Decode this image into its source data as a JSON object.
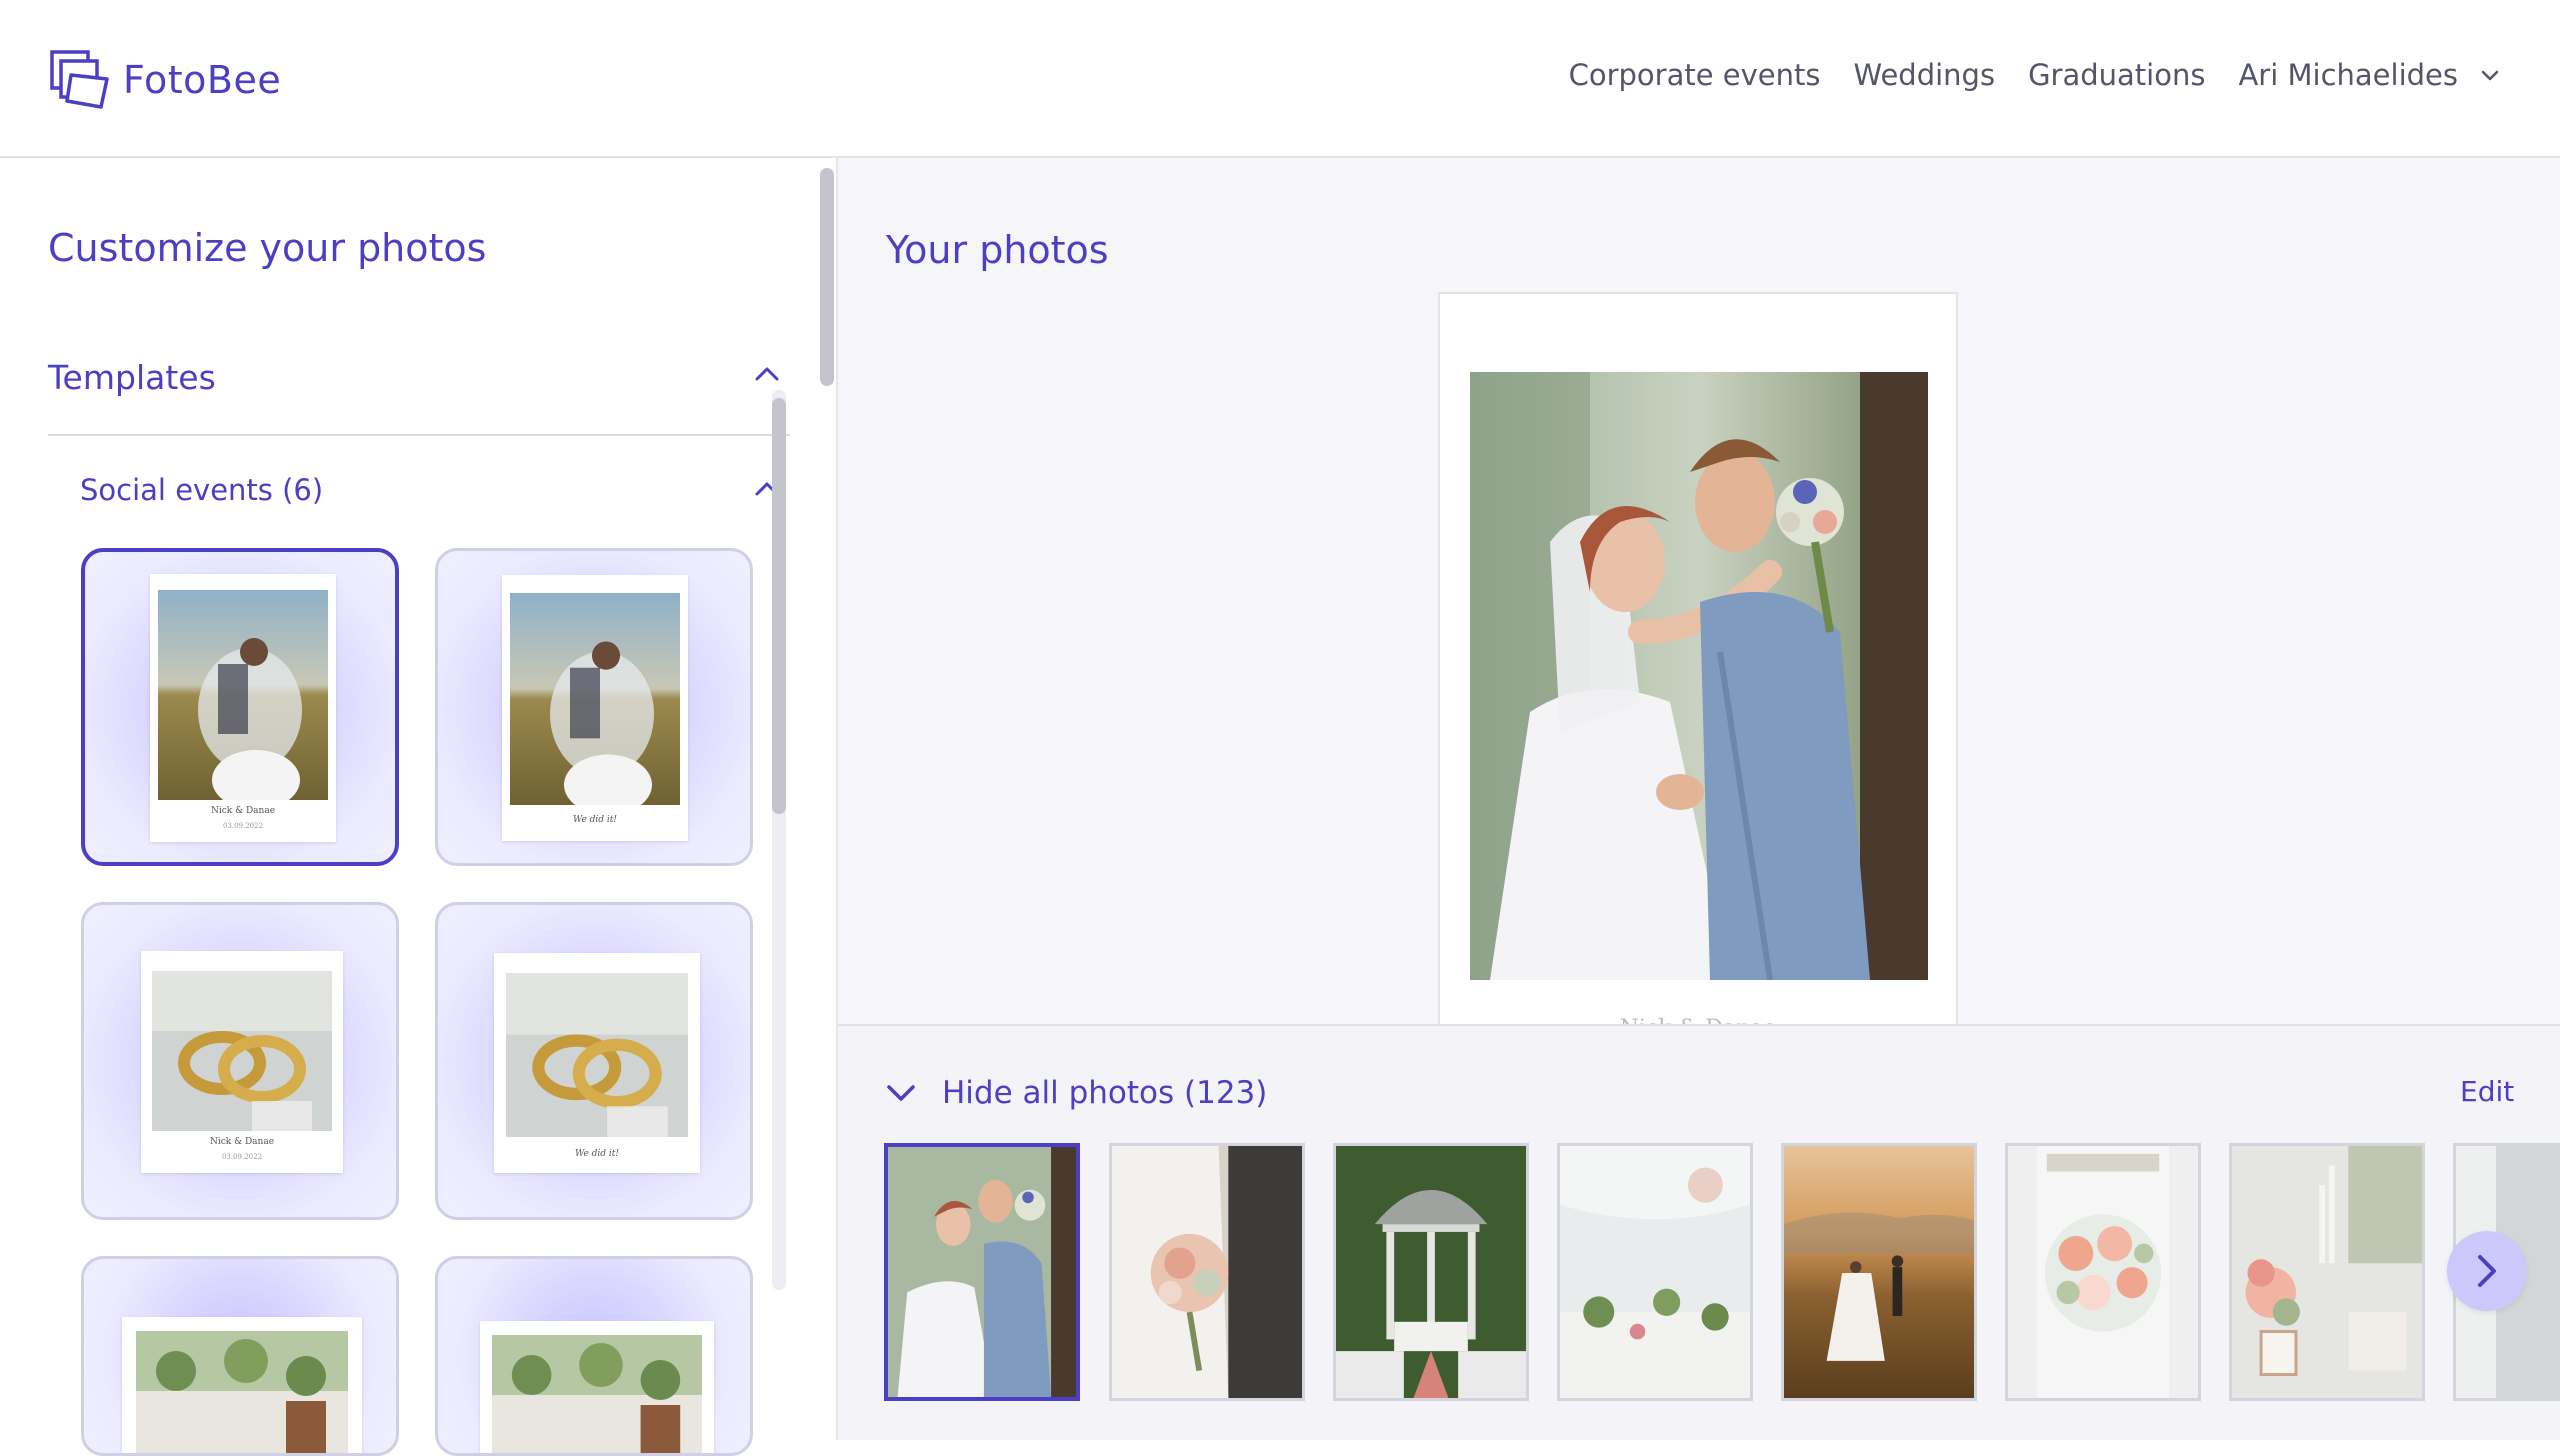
{
  "header": {
    "logo_text": "FotoBee",
    "nav": [
      "Corporate events",
      "Weddings",
      "Graduations"
    ],
    "user_name": "Ari Michaelides"
  },
  "customize": {
    "title": "Customize your photos",
    "section_label": "Templates",
    "subsection_label": "Social events (6)",
    "templates": [
      {
        "photo": "couple-veil-field",
        "caption": "Nick & Danae",
        "date": "03.09.2022",
        "selected": true
      },
      {
        "photo": "couple-veil-field",
        "caption": "We did it!",
        "selected": false
      },
      {
        "photo": "gold-wedding-rings",
        "caption": "Nick & Danae",
        "date": "03.09.2022",
        "selected": false
      },
      {
        "photo": "gold-wedding-rings",
        "caption": "We did it!",
        "selected": false
      },
      {
        "photo": "banquet-table",
        "selected": false
      },
      {
        "photo": "banquet-table",
        "selected": false
      }
    ]
  },
  "preview": {
    "title": "Your photos",
    "caption": "Nick & Danae"
  },
  "gallery": {
    "toggle_label": "Hide all photos (123)",
    "edit_label": "Edit",
    "thumbnails": [
      "couple-embrace",
      "bride-bouquet-groom",
      "garden-gazebo",
      "tent-reception-table",
      "couple-sunset-field",
      "bride-peach-bouquet",
      "table-candles-flowers",
      "partial-next"
    ]
  },
  "colors": {
    "accent": "#4b3fc4",
    "card_bg": "#e4e1ff",
    "next_button": "#cdc8fb"
  }
}
